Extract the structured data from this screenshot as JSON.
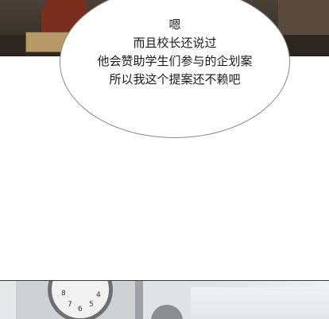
{
  "speech_bubble": {
    "lines": [
      "嗯",
      "而且校长还说过",
      "他会赞助学生们参与的企划案",
      "所以我这个提案还不赖吧"
    ]
  },
  "clock": {
    "visible_numerals": [
      "8",
      "7",
      "6",
      "5",
      "4"
    ]
  }
}
